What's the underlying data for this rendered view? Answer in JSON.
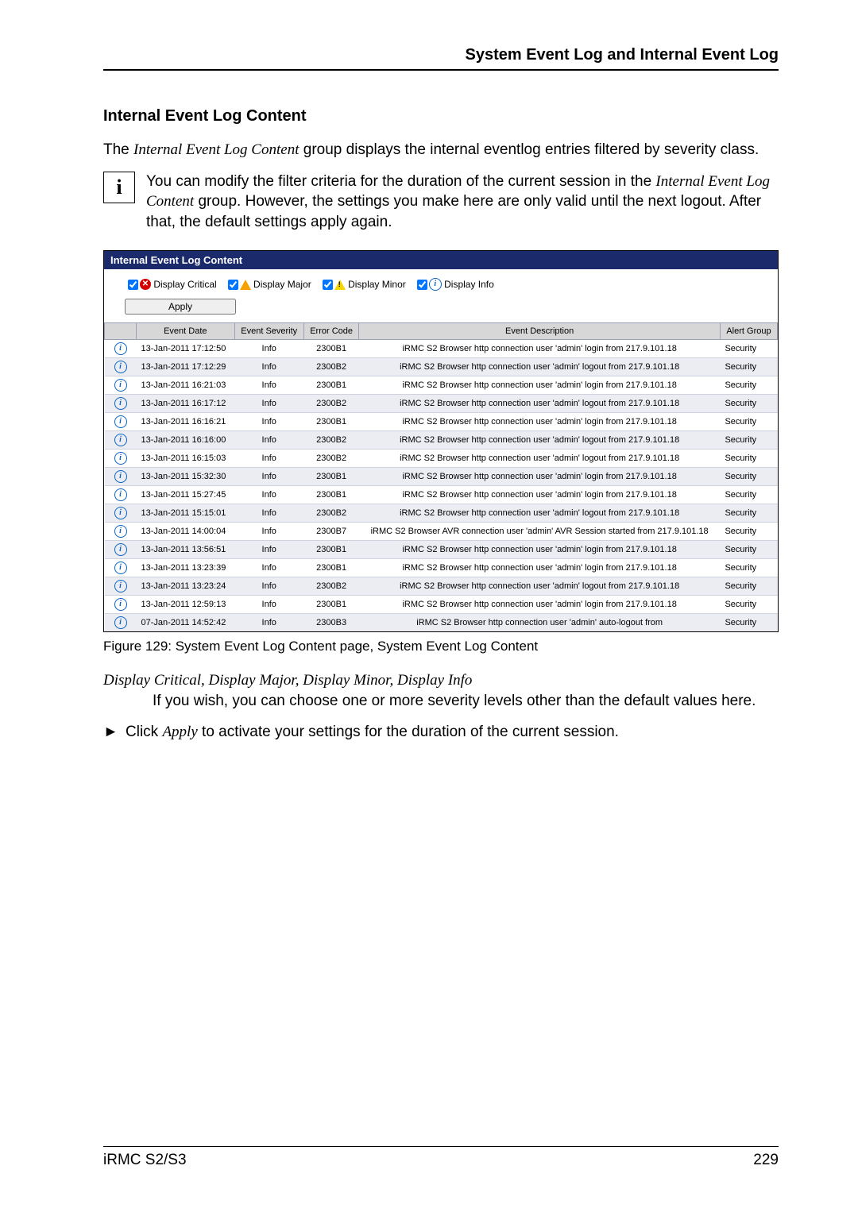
{
  "header": {
    "running": "System Event Log and Internal Event Log"
  },
  "section": {
    "title": "Internal Event Log Content",
    "intro_pre": "The ",
    "intro_em": "Internal Event Log Content",
    "intro_post": " group displays the internal eventlog entries filtered by severity class.",
    "note_pre": "You can modify the filter criteria for the duration of the current session in the ",
    "note_em": "Internal Event Log Content",
    "note_post": " group. However, the settings you make here are only valid until the next logout. After that, the default settings apply again."
  },
  "figure": {
    "title": "Internal Event Log Content",
    "filters": {
      "critical": "Display Critical",
      "major": "Display Major",
      "minor": "Display Minor",
      "info": "Display Info"
    },
    "apply": "Apply",
    "cols": {
      "icon": "",
      "date": "Event\nDate",
      "severity": "Event\nSeverity",
      "code": "Error\nCode",
      "desc": "Event\nDescription",
      "group": "Alert\nGroup"
    },
    "rows": [
      {
        "date": "13-Jan-2011 17:12:50",
        "sev": "Info",
        "code": "2300B1",
        "desc": "iRMC S2 Browser http connection user 'admin' login from 217.9.101.18",
        "grp": "Security"
      },
      {
        "date": "13-Jan-2011 17:12:29",
        "sev": "Info",
        "code": "2300B2",
        "desc": "iRMC S2 Browser http connection user 'admin' logout from 217.9.101.18",
        "grp": "Security"
      },
      {
        "date": "13-Jan-2011 16:21:03",
        "sev": "Info",
        "code": "2300B1",
        "desc": "iRMC S2 Browser http connection user 'admin' login from 217.9.101.18",
        "grp": "Security"
      },
      {
        "date": "13-Jan-2011 16:17:12",
        "sev": "Info",
        "code": "2300B2",
        "desc": "iRMC S2 Browser http connection user 'admin' logout from 217.9.101.18",
        "grp": "Security"
      },
      {
        "date": "13-Jan-2011 16:16:21",
        "sev": "Info",
        "code": "2300B1",
        "desc": "iRMC S2 Browser http connection user 'admin' login from 217.9.101.18",
        "grp": "Security"
      },
      {
        "date": "13-Jan-2011 16:16:00",
        "sev": "Info",
        "code": "2300B2",
        "desc": "iRMC S2 Browser http connection user 'admin' logout from 217.9.101.18",
        "grp": "Security"
      },
      {
        "date": "13-Jan-2011 16:15:03",
        "sev": "Info",
        "code": "2300B2",
        "desc": "iRMC S2 Browser http connection user 'admin' logout from 217.9.101.18",
        "grp": "Security"
      },
      {
        "date": "13-Jan-2011 15:32:30",
        "sev": "Info",
        "code": "2300B1",
        "desc": "iRMC S2 Browser http connection user 'admin' login from 217.9.101.18",
        "grp": "Security"
      },
      {
        "date": "13-Jan-2011 15:27:45",
        "sev": "Info",
        "code": "2300B1",
        "desc": "iRMC S2 Browser http connection user 'admin' login from 217.9.101.18",
        "grp": "Security"
      },
      {
        "date": "13-Jan-2011 15:15:01",
        "sev": "Info",
        "code": "2300B2",
        "desc": "iRMC S2 Browser http connection user 'admin' logout from 217.9.101.18",
        "grp": "Security"
      },
      {
        "date": "13-Jan-2011 14:00:04",
        "sev": "Info",
        "code": "2300B7",
        "desc": "iRMC S2 Browser AVR connection user 'admin' AVR Session started from 217.9.101.18",
        "grp": "Security"
      },
      {
        "date": "13-Jan-2011 13:56:51",
        "sev": "Info",
        "code": "2300B1",
        "desc": "iRMC S2 Browser http connection user 'admin' login from 217.9.101.18",
        "grp": "Security"
      },
      {
        "date": "13-Jan-2011 13:23:39",
        "sev": "Info",
        "code": "2300B1",
        "desc": "iRMC S2 Browser http connection user 'admin' login from 217.9.101.18",
        "grp": "Security"
      },
      {
        "date": "13-Jan-2011 13:23:24",
        "sev": "Info",
        "code": "2300B2",
        "desc": "iRMC S2 Browser http connection user 'admin' logout from 217.9.101.18",
        "grp": "Security"
      },
      {
        "date": "13-Jan-2011 12:59:13",
        "sev": "Info",
        "code": "2300B1",
        "desc": "iRMC S2 Browser http connection user 'admin' login from 217.9.101.18",
        "grp": "Security"
      },
      {
        "date": "07-Jan-2011 14:52:42",
        "sev": "Info",
        "code": "2300B3",
        "desc": "iRMC S2 Browser http connection user 'admin' auto-logout from",
        "grp": "Security"
      }
    ],
    "caption": "Figure 129: System Event Log Content page, System Event Log Content"
  },
  "terms": {
    "line": "Display Critical, Display Major, Display Minor, Display Info",
    "desc": "If you wish, you can choose one or more severity levels other than the default values here."
  },
  "bullet": {
    "mark": "►",
    "pre": "Click ",
    "em": "Apply",
    "post": " to activate your settings for the duration of the current session."
  },
  "footer": {
    "left": "iRMC S2/S3",
    "right": "229"
  }
}
